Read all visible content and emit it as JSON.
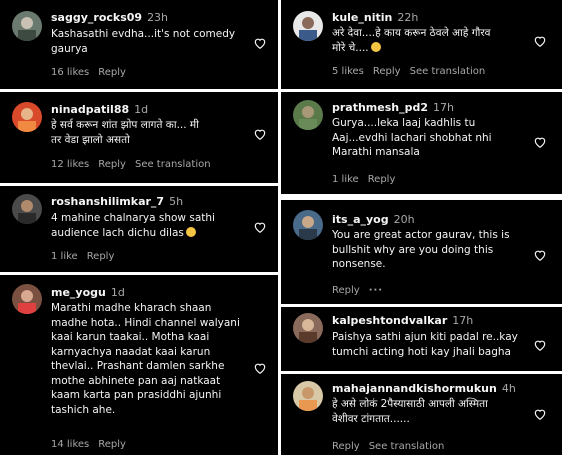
{
  "comments": [
    {
      "user": "saggy_rocks09",
      "time": "23h",
      "text": "Kashasathi evdha...it's not comedy\ngaurya",
      "likes": "16 likes",
      "reply": "Reply"
    },
    {
      "user": "kule_nitin",
      "time": "22h",
      "text": "अरे देवा....हे काय करून ठेवले आहे गौरव\nमोरे चे....",
      "emoji": "smiling-face",
      "likes": "5 likes",
      "reply": "Reply",
      "see_translation": "See translation"
    },
    {
      "user": "ninadpatil88",
      "time": "1d",
      "text": "हे सर्व करून शांत झोप लागते का... मी\nतर वेडा झालो असतो",
      "likes": "12 likes",
      "reply": "Reply",
      "see_translation": "See translation"
    },
    {
      "user": "prathmesh_pd2",
      "time": "17h",
      "text": "Gurya....leka laaj kadhlis tu\nAaj...evdhi lachari shobhat nhi\nMarathi mansala",
      "likes": "1 like",
      "reply": "Reply"
    },
    {
      "user": "roshanshilimkar_7",
      "time": "5h",
      "text": "4 mahine chalnarya show sathi\naudience lach dichu dilas",
      "emoji": "grinning-face",
      "likes": "1 like",
      "reply": "Reply"
    },
    {
      "user": "its_a_yog",
      "time": "20h",
      "text": "You are great actor gaurav, this is\nbullshit why are you doing this\nnonsense.",
      "reply": "Reply"
    },
    {
      "user": "me_yogu",
      "time": "1d",
      "text": "Marathi madhe kharach shaan\nmadhe hota.. Hindi channel walyani\nkaai karun taakai.. Motha kaai\nkarnyachya naadat kaai karun\nthevlai.. Prashant damlen sarkhe\nmothe abhinete pan aaj natkaat\nkaam karta pan prasiddhi ajunhi\ntashich ahe.",
      "likes": "14 likes",
      "reply": "Reply"
    },
    {
      "user": "kalpeshtondvalkar",
      "time": "17h",
      "text": "Paishya sathi ajun kiti padal re..kay\ntumchi acting hoti kay jhali bagha"
    },
    {
      "user": "mahajannandkishormukun",
      "time": "4h",
      "text": "हे असे लोकं 2पैस्यासाठी आपली अस्मिता\nवेशीवर टांगतात......",
      "reply": "Reply",
      "see_translation": "See translation"
    }
  ],
  "colors": {
    "background": "#000000",
    "username": "#f5f5f5",
    "secondary_text": "#a8a8a8",
    "separator": "#ffffff"
  },
  "icons": [
    "heart-outline-icon",
    "more-options-icon",
    "avatar"
  ]
}
